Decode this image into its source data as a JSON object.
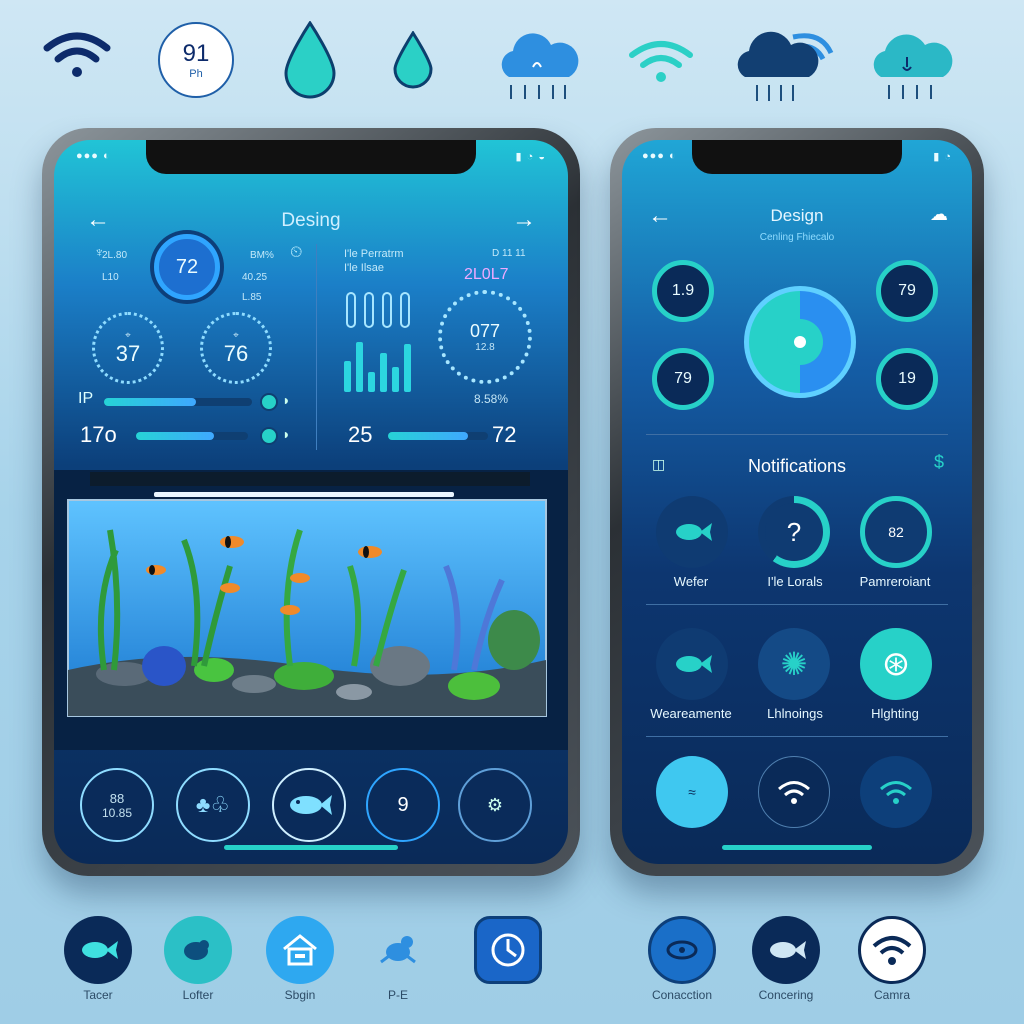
{
  "top_icons": [
    {
      "name": "wifi-icon"
    },
    {
      "name": "ph-gauge-icon",
      "value": "91",
      "unit": "Ph"
    },
    {
      "name": "water-drop-icon"
    },
    {
      "name": "water-drop-small-icon"
    },
    {
      "name": "cloud-rain-icon"
    },
    {
      "name": "wifi-teal-icon"
    },
    {
      "name": "storm-cloud-icon"
    },
    {
      "name": "cloud-teal-icon"
    }
  ],
  "left_phone": {
    "title": "Desing",
    "left_gauges": {
      "main_value": "72",
      "labels": [
        "2L.80",
        "L10",
        "BM%",
        "40.25",
        "L.85"
      ],
      "ring_a_value": "37",
      "ring_b_value": "76",
      "slider1_label": "IP",
      "slider1_fill": 0.62,
      "slider2_value": "17o",
      "slider2_fill": 0.7
    },
    "right_panel": {
      "title": "I'le Perratrm",
      "subtitle": "I'le Ilsae",
      "top_label": "D 11 11",
      "reading": "2L0L7",
      "dial_value": "077",
      "dial_sub": "12.8",
      "pct": "8.58%",
      "slider_left": "25",
      "slider_right": "72",
      "slider_fill": 0.8,
      "bars": [
        0.55,
        0.9,
        0.35,
        0.7,
        0.45,
        0.85
      ]
    },
    "bottom_nav": [
      {
        "name": "stats-button",
        "line1": "88",
        "line2": "10.85"
      },
      {
        "name": "plants-button",
        "line1": "",
        "line2": ""
      },
      {
        "name": "fish-button",
        "line1": "",
        "line2": ""
      },
      {
        "name": "temp-button",
        "line1": "9",
        "line2": ""
      },
      {
        "name": "settings-button",
        "line1": "",
        "line2": ""
      }
    ]
  },
  "right_phone": {
    "title": "Design",
    "subtitle": "Cenling Fhiecalo",
    "rings": [
      {
        "name": "ring-tl",
        "value": "1.9"
      },
      {
        "name": "ring-tr",
        "value": "79"
      },
      {
        "name": "ring-bl",
        "value": "79"
      },
      {
        "name": "ring-br",
        "value": "19"
      }
    ],
    "section_title": "Notifications",
    "row1": [
      {
        "name": "water-button",
        "label": "Wefer"
      },
      {
        "name": "lr-lorals-button",
        "label": "I'le Lorals"
      },
      {
        "name": "parameters-button",
        "label": "Pamreroiant",
        "value": "82"
      }
    ],
    "row2": [
      {
        "name": "warnings-button",
        "label": "Weareamente"
      },
      {
        "name": "lighting-button",
        "label": "Lhlnoings"
      },
      {
        "name": "flighting-button",
        "label": "Hlghting"
      }
    ]
  },
  "bottom_icons": [
    {
      "name": "fish-nav-icon",
      "label": "Tacer"
    },
    {
      "name": "bird-nav-icon",
      "label": "Lofter"
    },
    {
      "name": "home-nav-icon",
      "label": "Sbgin"
    },
    {
      "name": "crab-nav-icon",
      "label": "P-E"
    },
    {
      "name": "clock-nav-icon",
      "label": ""
    },
    {
      "name": "connection-nav-icon",
      "label": "Conacction"
    },
    {
      "name": "concering-nav-icon",
      "label": "Concering"
    },
    {
      "name": "camera-nav-icon",
      "label": "Camra"
    }
  ],
  "colors": {
    "accent": "#27d1c8",
    "blue": "#2a8ff0",
    "navy": "#0a2a58"
  }
}
